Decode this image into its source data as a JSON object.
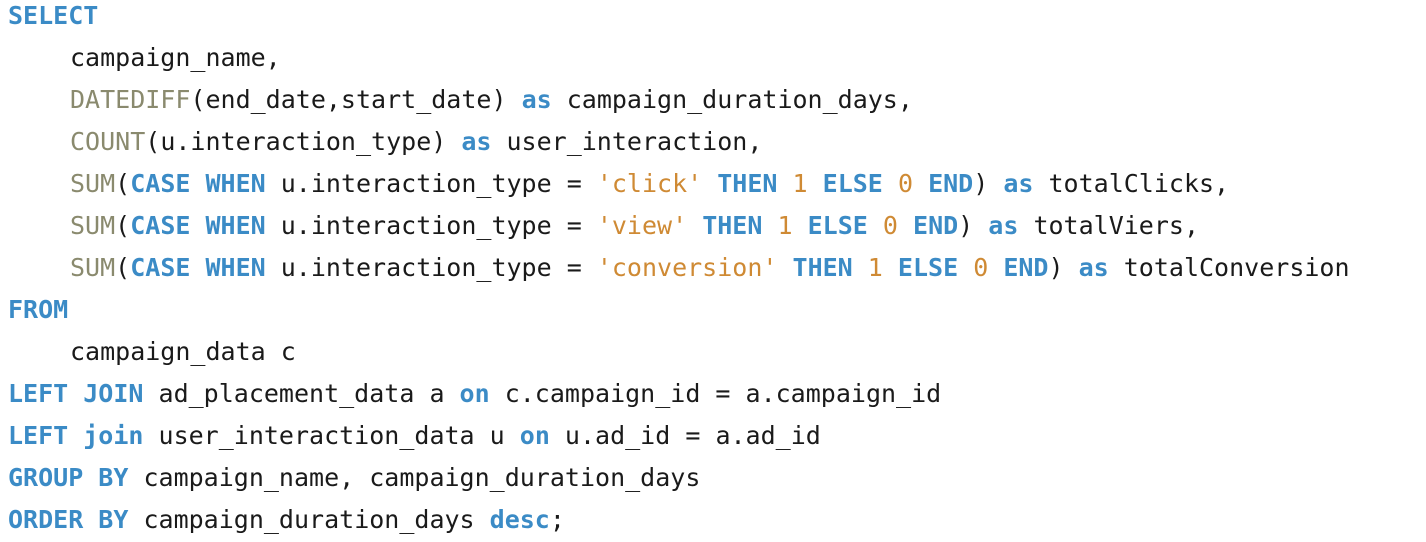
{
  "colors": {
    "keyword": "#3b8bc6",
    "function": "#8a8a6e",
    "string": "#cf8a34",
    "number": "#cf8a34",
    "text": "#1a1a1a",
    "background": "#ffffff"
  },
  "lines": [
    {
      "indent": false,
      "tokens": [
        {
          "t": "SELECT",
          "k": "kw"
        }
      ]
    },
    {
      "indent": true,
      "tokens": [
        {
          "t": "campaign_name,",
          "k": "id"
        }
      ]
    },
    {
      "indent": true,
      "tokens": [
        {
          "t": "DATEDIFF",
          "k": "fn"
        },
        {
          "t": "(end_date,start_date) ",
          "k": "id"
        },
        {
          "t": "as",
          "k": "kw"
        },
        {
          "t": " campaign_duration_days,",
          "k": "id"
        }
      ]
    },
    {
      "indent": true,
      "tokens": [
        {
          "t": "COUNT",
          "k": "fn"
        },
        {
          "t": "(u.interaction_type) ",
          "k": "id"
        },
        {
          "t": "as",
          "k": "kw"
        },
        {
          "t": " user_interaction,",
          "k": "id"
        }
      ]
    },
    {
      "indent": true,
      "tokens": [
        {
          "t": "SUM",
          "k": "fn"
        },
        {
          "t": "(",
          "k": "punct"
        },
        {
          "t": "CASE WHEN",
          "k": "kw"
        },
        {
          "t": " u.interaction_type = ",
          "k": "id"
        },
        {
          "t": "'click'",
          "k": "str"
        },
        {
          "t": " ",
          "k": "id"
        },
        {
          "t": "THEN",
          "k": "kw"
        },
        {
          "t": " ",
          "k": "id"
        },
        {
          "t": "1",
          "k": "num"
        },
        {
          "t": " ",
          "k": "id"
        },
        {
          "t": "ELSE",
          "k": "kw"
        },
        {
          "t": " ",
          "k": "id"
        },
        {
          "t": "0",
          "k": "num"
        },
        {
          "t": " ",
          "k": "id"
        },
        {
          "t": "END",
          "k": "kw"
        },
        {
          "t": ") ",
          "k": "punct"
        },
        {
          "t": "as",
          "k": "kw"
        },
        {
          "t": " totalClicks,",
          "k": "id"
        }
      ]
    },
    {
      "indent": true,
      "tokens": [
        {
          "t": "SUM",
          "k": "fn"
        },
        {
          "t": "(",
          "k": "punct"
        },
        {
          "t": "CASE WHEN",
          "k": "kw"
        },
        {
          "t": " u.interaction_type = ",
          "k": "id"
        },
        {
          "t": "'view'",
          "k": "str"
        },
        {
          "t": " ",
          "k": "id"
        },
        {
          "t": "THEN",
          "k": "kw"
        },
        {
          "t": " ",
          "k": "id"
        },
        {
          "t": "1",
          "k": "num"
        },
        {
          "t": " ",
          "k": "id"
        },
        {
          "t": "ELSE",
          "k": "kw"
        },
        {
          "t": " ",
          "k": "id"
        },
        {
          "t": "0",
          "k": "num"
        },
        {
          "t": " ",
          "k": "id"
        },
        {
          "t": "END",
          "k": "kw"
        },
        {
          "t": ") ",
          "k": "punct"
        },
        {
          "t": "as",
          "k": "kw"
        },
        {
          "t": " totalViers,",
          "k": "id"
        }
      ]
    },
    {
      "indent": true,
      "tokens": [
        {
          "t": "SUM",
          "k": "fn"
        },
        {
          "t": "(",
          "k": "punct"
        },
        {
          "t": "CASE WHEN",
          "k": "kw"
        },
        {
          "t": " u.interaction_type = ",
          "k": "id"
        },
        {
          "t": "'conversion'",
          "k": "str"
        },
        {
          "t": " ",
          "k": "id"
        },
        {
          "t": "THEN",
          "k": "kw"
        },
        {
          "t": " ",
          "k": "id"
        },
        {
          "t": "1",
          "k": "num"
        },
        {
          "t": " ",
          "k": "id"
        },
        {
          "t": "ELSE",
          "k": "kw"
        },
        {
          "t": " ",
          "k": "id"
        },
        {
          "t": "0",
          "k": "num"
        },
        {
          "t": " ",
          "k": "id"
        },
        {
          "t": "END",
          "k": "kw"
        },
        {
          "t": ") ",
          "k": "punct"
        },
        {
          "t": "as",
          "k": "kw"
        },
        {
          "t": " totalConversion",
          "k": "id"
        }
      ]
    },
    {
      "indent": false,
      "tokens": [
        {
          "t": "FROM",
          "k": "kw"
        }
      ]
    },
    {
      "indent": true,
      "tokens": [
        {
          "t": "campaign_data c",
          "k": "id"
        }
      ]
    },
    {
      "indent": false,
      "tokens": [
        {
          "t": "LEFT JOIN",
          "k": "kw"
        },
        {
          "t": " ad_placement_data a ",
          "k": "id"
        },
        {
          "t": "on",
          "k": "kw"
        },
        {
          "t": " c.campaign_id = a.campaign_id",
          "k": "id"
        }
      ]
    },
    {
      "indent": false,
      "tokens": [
        {
          "t": "LEFT join",
          "k": "kw"
        },
        {
          "t": " user_interaction_data u ",
          "k": "id"
        },
        {
          "t": "on",
          "k": "kw"
        },
        {
          "t": " u.ad_id = a.ad_id",
          "k": "id"
        }
      ]
    },
    {
      "indent": false,
      "tokens": [
        {
          "t": "GROUP BY",
          "k": "kw"
        },
        {
          "t": " campaign_name, campaign_duration_days",
          "k": "id"
        }
      ]
    },
    {
      "indent": false,
      "tokens": [
        {
          "t": "ORDER BY",
          "k": "kw"
        },
        {
          "t": " campaign_duration_days ",
          "k": "id"
        },
        {
          "t": "desc",
          "k": "kw"
        },
        {
          "t": ";",
          "k": "punct"
        }
      ]
    }
  ]
}
